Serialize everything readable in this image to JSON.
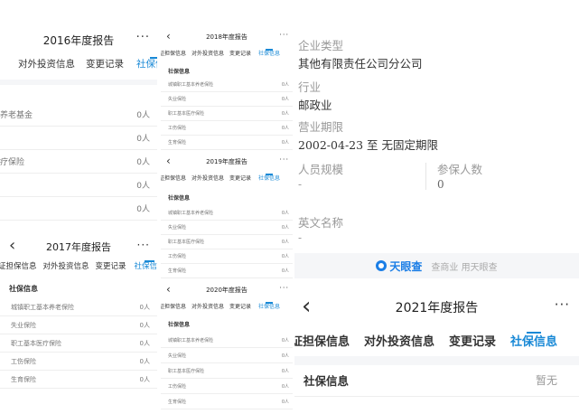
{
  "p2016": {
    "title": "2016年度报告",
    "more": "···",
    "tabs": [
      "对外投资信息",
      "变更记录",
      "社保信息"
    ],
    "rows": [
      {
        "name": "养老基金",
        "value": "0人"
      },
      {
        "name": "",
        "value": "0人"
      },
      {
        "name": "疗保险",
        "value": "0人"
      },
      {
        "name": "",
        "value": "0人"
      },
      {
        "name": "",
        "value": "0人"
      }
    ]
  },
  "p2018": {
    "back": "‹",
    "title": "2018年度报告",
    "more": "···",
    "tabs": [
      "证担保信息",
      "对外投资信息",
      "变更记录",
      "社保信息"
    ],
    "section": "社保信息",
    "rows": [
      {
        "name": "城镇职工基本养老保险",
        "value": "0人"
      },
      {
        "name": "失业保险",
        "value": "0人"
      },
      {
        "name": "职工基本医疗保险",
        "value": "0人"
      },
      {
        "name": "工伤保险",
        "value": "0人"
      },
      {
        "name": "生育保险",
        "value": "0人"
      }
    ]
  },
  "p2019": {
    "back": "‹",
    "title": "2019年度报告",
    "more": "···",
    "tabs": [
      "证担保信息",
      "对外投资信息",
      "变更记录",
      "社保信息"
    ],
    "section": "社保信息",
    "rows": [
      {
        "name": "城镇职工基本养老保险",
        "value": "0人"
      },
      {
        "name": "失业保险",
        "value": "0人"
      },
      {
        "name": "职工基本医疗保险",
        "value": "0人"
      },
      {
        "name": "工伤保险",
        "value": "0人"
      },
      {
        "name": "生育保险",
        "value": "0人"
      }
    ]
  },
  "p2020": {
    "back": "‹",
    "title": "2020年度报告",
    "more": "···",
    "tabs": [
      "证担保信息",
      "对外投资信息",
      "变更记录",
      "社保信息"
    ],
    "section": "社保信息",
    "rows": [
      {
        "name": "城镇职工基本养老保险",
        "value": "0人"
      },
      {
        "name": "失业保险",
        "value": "0人"
      },
      {
        "name": "职工基本医疗保险",
        "value": "0人"
      },
      {
        "name": "工伤保险",
        "value": "0人"
      },
      {
        "name": "生育保险",
        "value": "0人"
      }
    ]
  },
  "p2017": {
    "back": "‹",
    "title": "2017年度报告",
    "more": "···",
    "tabs": [
      "证担保信息",
      "对外投资信息",
      "变更记录",
      "社保信息"
    ],
    "section": "社保信息",
    "rows": [
      {
        "name": "城镇职工基本养老保险",
        "value": "0人"
      },
      {
        "name": "失业保险",
        "value": "0人"
      },
      {
        "name": "职工基本医疗保险",
        "value": "0人"
      },
      {
        "name": "工伤保险",
        "value": "0人"
      },
      {
        "name": "生育保险",
        "value": "0人"
      }
    ]
  },
  "company": {
    "type_label": "企业类型",
    "type_value": "其他有限责任公司分公司",
    "industry_label": "行业",
    "industry_value": "邮政业",
    "term_label": "营业期限",
    "term_value": "2002-04-23 至 无固定期限",
    "staff_label": "人员规模",
    "staff_value": "-",
    "insured_label": "参保人数",
    "insured_value": "0",
    "en_label": "英文名称",
    "en_value": "-",
    "brand": "天眼查",
    "slogan": "查商业 用天眼查"
  },
  "p2021": {
    "back": "‹",
    "title": "2021年度报告",
    "more": "···",
    "tabs": [
      "证担保信息",
      "对外投资信息",
      "变更记录",
      "社保信息"
    ],
    "section": "社保信息",
    "section_value": "暂无"
  },
  "colors": {
    "accent": "#1989d6",
    "brand": "#1b7ee6"
  }
}
